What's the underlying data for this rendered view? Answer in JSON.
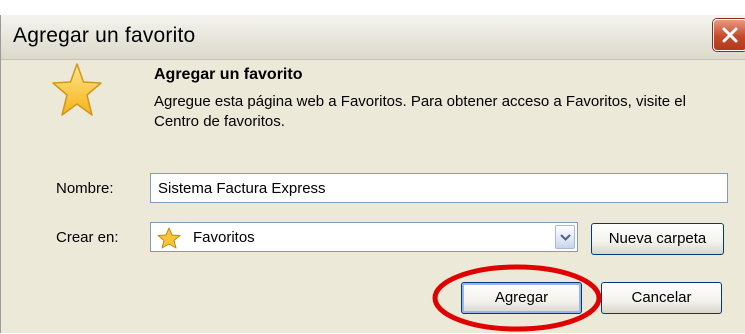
{
  "window": {
    "title": "Agregar un favorito"
  },
  "header": {
    "title": "Agregar un favorito",
    "description": "Agregue esta página web a Favoritos. Para obtener acceso a Favoritos, visite el Centro de favoritos."
  },
  "form": {
    "name_label": "Nombre:",
    "name_value": "Sistema Factura Express",
    "create_in_label": "Crear en:",
    "create_in_value": "Favoritos"
  },
  "buttons": {
    "new_folder": "Nueva carpeta",
    "add": "Agregar",
    "cancel": "Cancelar"
  },
  "colors": {
    "dialog_bg": "#ece9d8",
    "highlight": "#e00000",
    "star": "#f7c535"
  }
}
